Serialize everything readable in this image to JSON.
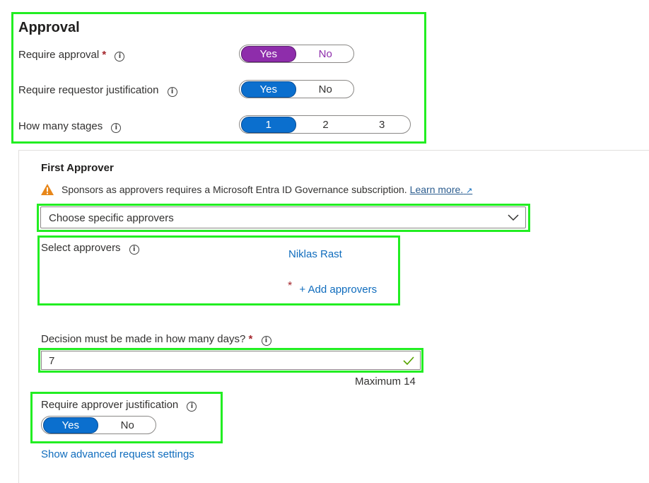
{
  "approval": {
    "title": "Approval",
    "require_approval": {
      "label": "Require approval",
      "required_mark": "*",
      "options": [
        "Yes",
        "No"
      ],
      "selected": "Yes"
    },
    "require_justification": {
      "label": "Require requestor justification",
      "options": [
        "Yes",
        "No"
      ],
      "selected": "Yes"
    },
    "stages": {
      "label": "How many stages",
      "options": [
        "1",
        "2",
        "3"
      ],
      "selected": "1"
    }
  },
  "first_approver": {
    "title": "First Approver",
    "warning_text": "Sponsors as approvers requires a Microsoft Entra ID Governance subscription.",
    "learn_more": "Learn more.",
    "dropdown_value": "Choose specific approvers",
    "select_approvers_label": "Select approvers",
    "approver_name": "Niklas Rast",
    "required_mark": "*",
    "add_approvers": "+ Add approvers",
    "decision_label": "Decision must be made in how many days?",
    "decision_required_mark": "*",
    "decision_value": "7",
    "decision_hint": "Maximum 14",
    "approver_justification_label": "Require approver justification",
    "approver_justification_options": [
      "Yes",
      "No"
    ],
    "approver_justification_selected": "Yes",
    "advanced_link": "Show advanced request settings"
  },
  "colors": {
    "highlight": "#22ee22",
    "accent_blue": "#0b6fce",
    "accent_purple": "#8e2dab",
    "link": "#0f6cbd",
    "required": "#a4262c",
    "warning": "#e8871a",
    "valid": "#57a300"
  }
}
